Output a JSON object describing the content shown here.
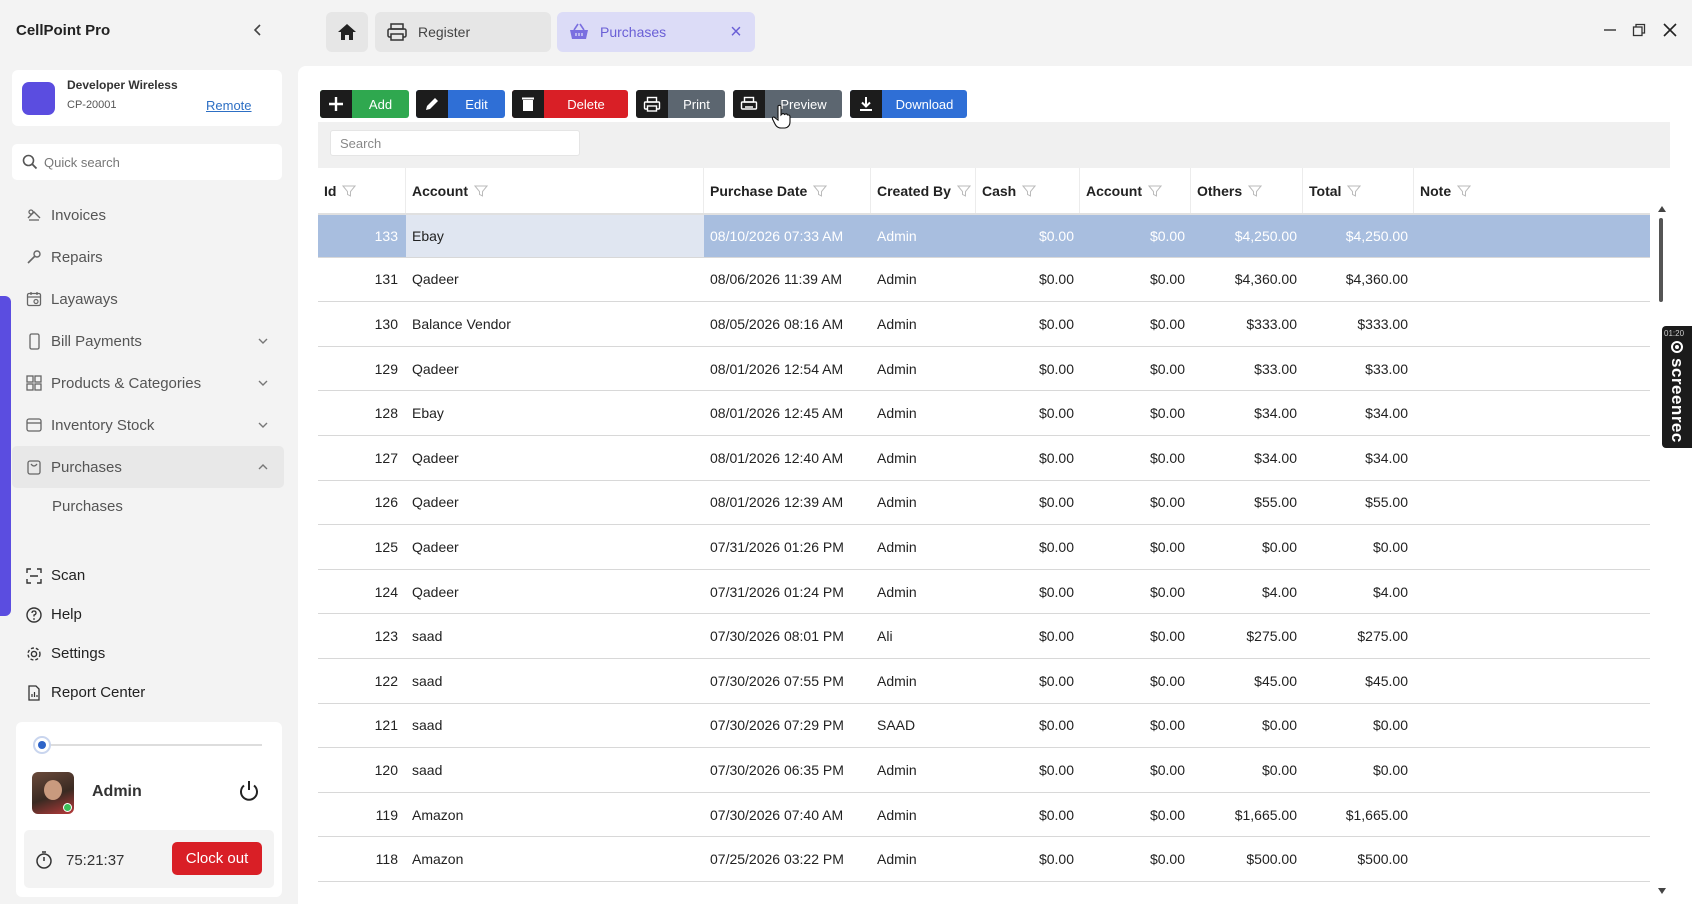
{
  "app": {
    "title": "CellPoint Pro"
  },
  "store": {
    "name": "Developer Wireless",
    "code": "CP-20001",
    "link": "Remote"
  },
  "quick_search": {
    "placeholder": "Quick search"
  },
  "nav": {
    "items": [
      {
        "label": "Invoices",
        "icon": "invoices-icon"
      },
      {
        "label": "Repairs",
        "icon": "wrench-icon"
      },
      {
        "label": "Layaways",
        "icon": "calendar-icon"
      },
      {
        "label": "Bill Payments",
        "icon": "phone-icon",
        "expandable": true
      },
      {
        "label": "Products & Categories",
        "icon": "grid-icon",
        "expandable": true
      },
      {
        "label": "Inventory Stock",
        "icon": "box-icon",
        "expandable": true
      },
      {
        "label": "Purchases",
        "icon": "bag-icon",
        "expanded": true,
        "active": true
      }
    ],
    "sub_items": [
      "Purchases"
    ],
    "lower_items": [
      {
        "label": "Scan",
        "icon": "scan-icon"
      },
      {
        "label": "Help",
        "icon": "help-icon"
      },
      {
        "label": "Settings",
        "icon": "gear-icon"
      },
      {
        "label": "Report Center",
        "icon": "report-icon"
      }
    ]
  },
  "user": {
    "name": "Admin",
    "timer": "75:21:37",
    "clock_out_label": "Clock out"
  },
  "tabs": [
    {
      "label": "Register",
      "icon": "printer-icon"
    },
    {
      "label": "Purchases",
      "icon": "basket-icon",
      "active": true
    }
  ],
  "toolbar": {
    "add": "Add",
    "edit": "Edit",
    "delete": "Delete",
    "print": "Print",
    "preview": "Preview",
    "download": "Download"
  },
  "grid_search": {
    "placeholder": "Search"
  },
  "columns": [
    "Id",
    "Account",
    "Purchase Date",
    "Created By",
    "Cash",
    "Account",
    "Others",
    "Total",
    "Note"
  ],
  "rows": [
    {
      "id": "133",
      "account": "Ebay",
      "date": "08/10/2026 07:33 AM",
      "created_by": "Admin",
      "cash": "$0.00",
      "account_amt": "$0.00",
      "others": "$4,250.00",
      "total": "$4,250.00",
      "note": ""
    },
    {
      "id": "131",
      "account": "Qadeer",
      "date": "08/06/2026 11:39 AM",
      "created_by": "Admin",
      "cash": "$0.00",
      "account_amt": "$0.00",
      "others": "$4,360.00",
      "total": "$4,360.00",
      "note": ""
    },
    {
      "id": "130",
      "account": "Balance Vendor",
      "date": "08/05/2026 08:16 AM",
      "created_by": "Admin",
      "cash": "$0.00",
      "account_amt": "$0.00",
      "others": "$333.00",
      "total": "$333.00",
      "note": ""
    },
    {
      "id": "129",
      "account": "Qadeer",
      "date": "08/01/2026 12:54 AM",
      "created_by": "Admin",
      "cash": "$0.00",
      "account_amt": "$0.00",
      "others": "$33.00",
      "total": "$33.00",
      "note": ""
    },
    {
      "id": "128",
      "account": "Ebay",
      "date": "08/01/2026 12:45 AM",
      "created_by": "Admin",
      "cash": "$0.00",
      "account_amt": "$0.00",
      "others": "$34.00",
      "total": "$34.00",
      "note": ""
    },
    {
      "id": "127",
      "account": "Qadeer",
      "date": "08/01/2026 12:40 AM",
      "created_by": "Admin",
      "cash": "$0.00",
      "account_amt": "$0.00",
      "others": "$34.00",
      "total": "$34.00",
      "note": ""
    },
    {
      "id": "126",
      "account": "Qadeer",
      "date": "08/01/2026 12:39 AM",
      "created_by": "Admin",
      "cash": "$0.00",
      "account_amt": "$0.00",
      "others": "$55.00",
      "total": "$55.00",
      "note": ""
    },
    {
      "id": "125",
      "account": "Qadeer",
      "date": "07/31/2026 01:26 PM",
      "created_by": "Admin",
      "cash": "$0.00",
      "account_amt": "$0.00",
      "others": "$0.00",
      "total": "$0.00",
      "note": ""
    },
    {
      "id": "124",
      "account": "Qadeer",
      "date": "07/31/2026 01:24 PM",
      "created_by": "Admin",
      "cash": "$0.00",
      "account_amt": "$0.00",
      "others": "$4.00",
      "total": "$4.00",
      "note": ""
    },
    {
      "id": "123",
      "account": "saad",
      "date": "07/30/2026 08:01 PM",
      "created_by": "Ali",
      "cash": "$0.00",
      "account_amt": "$0.00",
      "others": "$275.00",
      "total": "$275.00",
      "note": ""
    },
    {
      "id": "122",
      "account": "saad",
      "date": "07/30/2026 07:55 PM",
      "created_by": "Admin",
      "cash": "$0.00",
      "account_amt": "$0.00",
      "others": "$45.00",
      "total": "$45.00",
      "note": ""
    },
    {
      "id": "121",
      "account": "saad",
      "date": "07/30/2026 07:29 PM",
      "created_by": "SAAD",
      "cash": "$0.00",
      "account_amt": "$0.00",
      "others": "$0.00",
      "total": "$0.00",
      "note": ""
    },
    {
      "id": "120",
      "account": "saad",
      "date": "07/30/2026 06:35 PM",
      "created_by": "Admin",
      "cash": "$0.00",
      "account_amt": "$0.00",
      "others": "$0.00",
      "total": "$0.00",
      "note": ""
    },
    {
      "id": "119",
      "account": "Amazon",
      "date": "07/30/2026 07:40 AM",
      "created_by": "Admin",
      "cash": "$0.00",
      "account_amt": "$0.00",
      "others": "$1,665.00",
      "total": "$1,665.00",
      "note": ""
    },
    {
      "id": "118",
      "account": "Amazon",
      "date": "07/25/2026 03:22 PM",
      "created_by": "Admin",
      "cash": "$0.00",
      "account_amt": "$0.00",
      "others": "$500.00",
      "total": "$500.00",
      "note": ""
    }
  ],
  "selected_row_index": 0,
  "recorder": {
    "time": "01:20",
    "label": "screenrec"
  },
  "colors": {
    "accent": "#5b4de0",
    "add": "#2fa84f",
    "edit": "#2f6fd6",
    "delete": "#d91f26",
    "neutral": "#5c6670",
    "selected_row": "#a8bedf"
  }
}
